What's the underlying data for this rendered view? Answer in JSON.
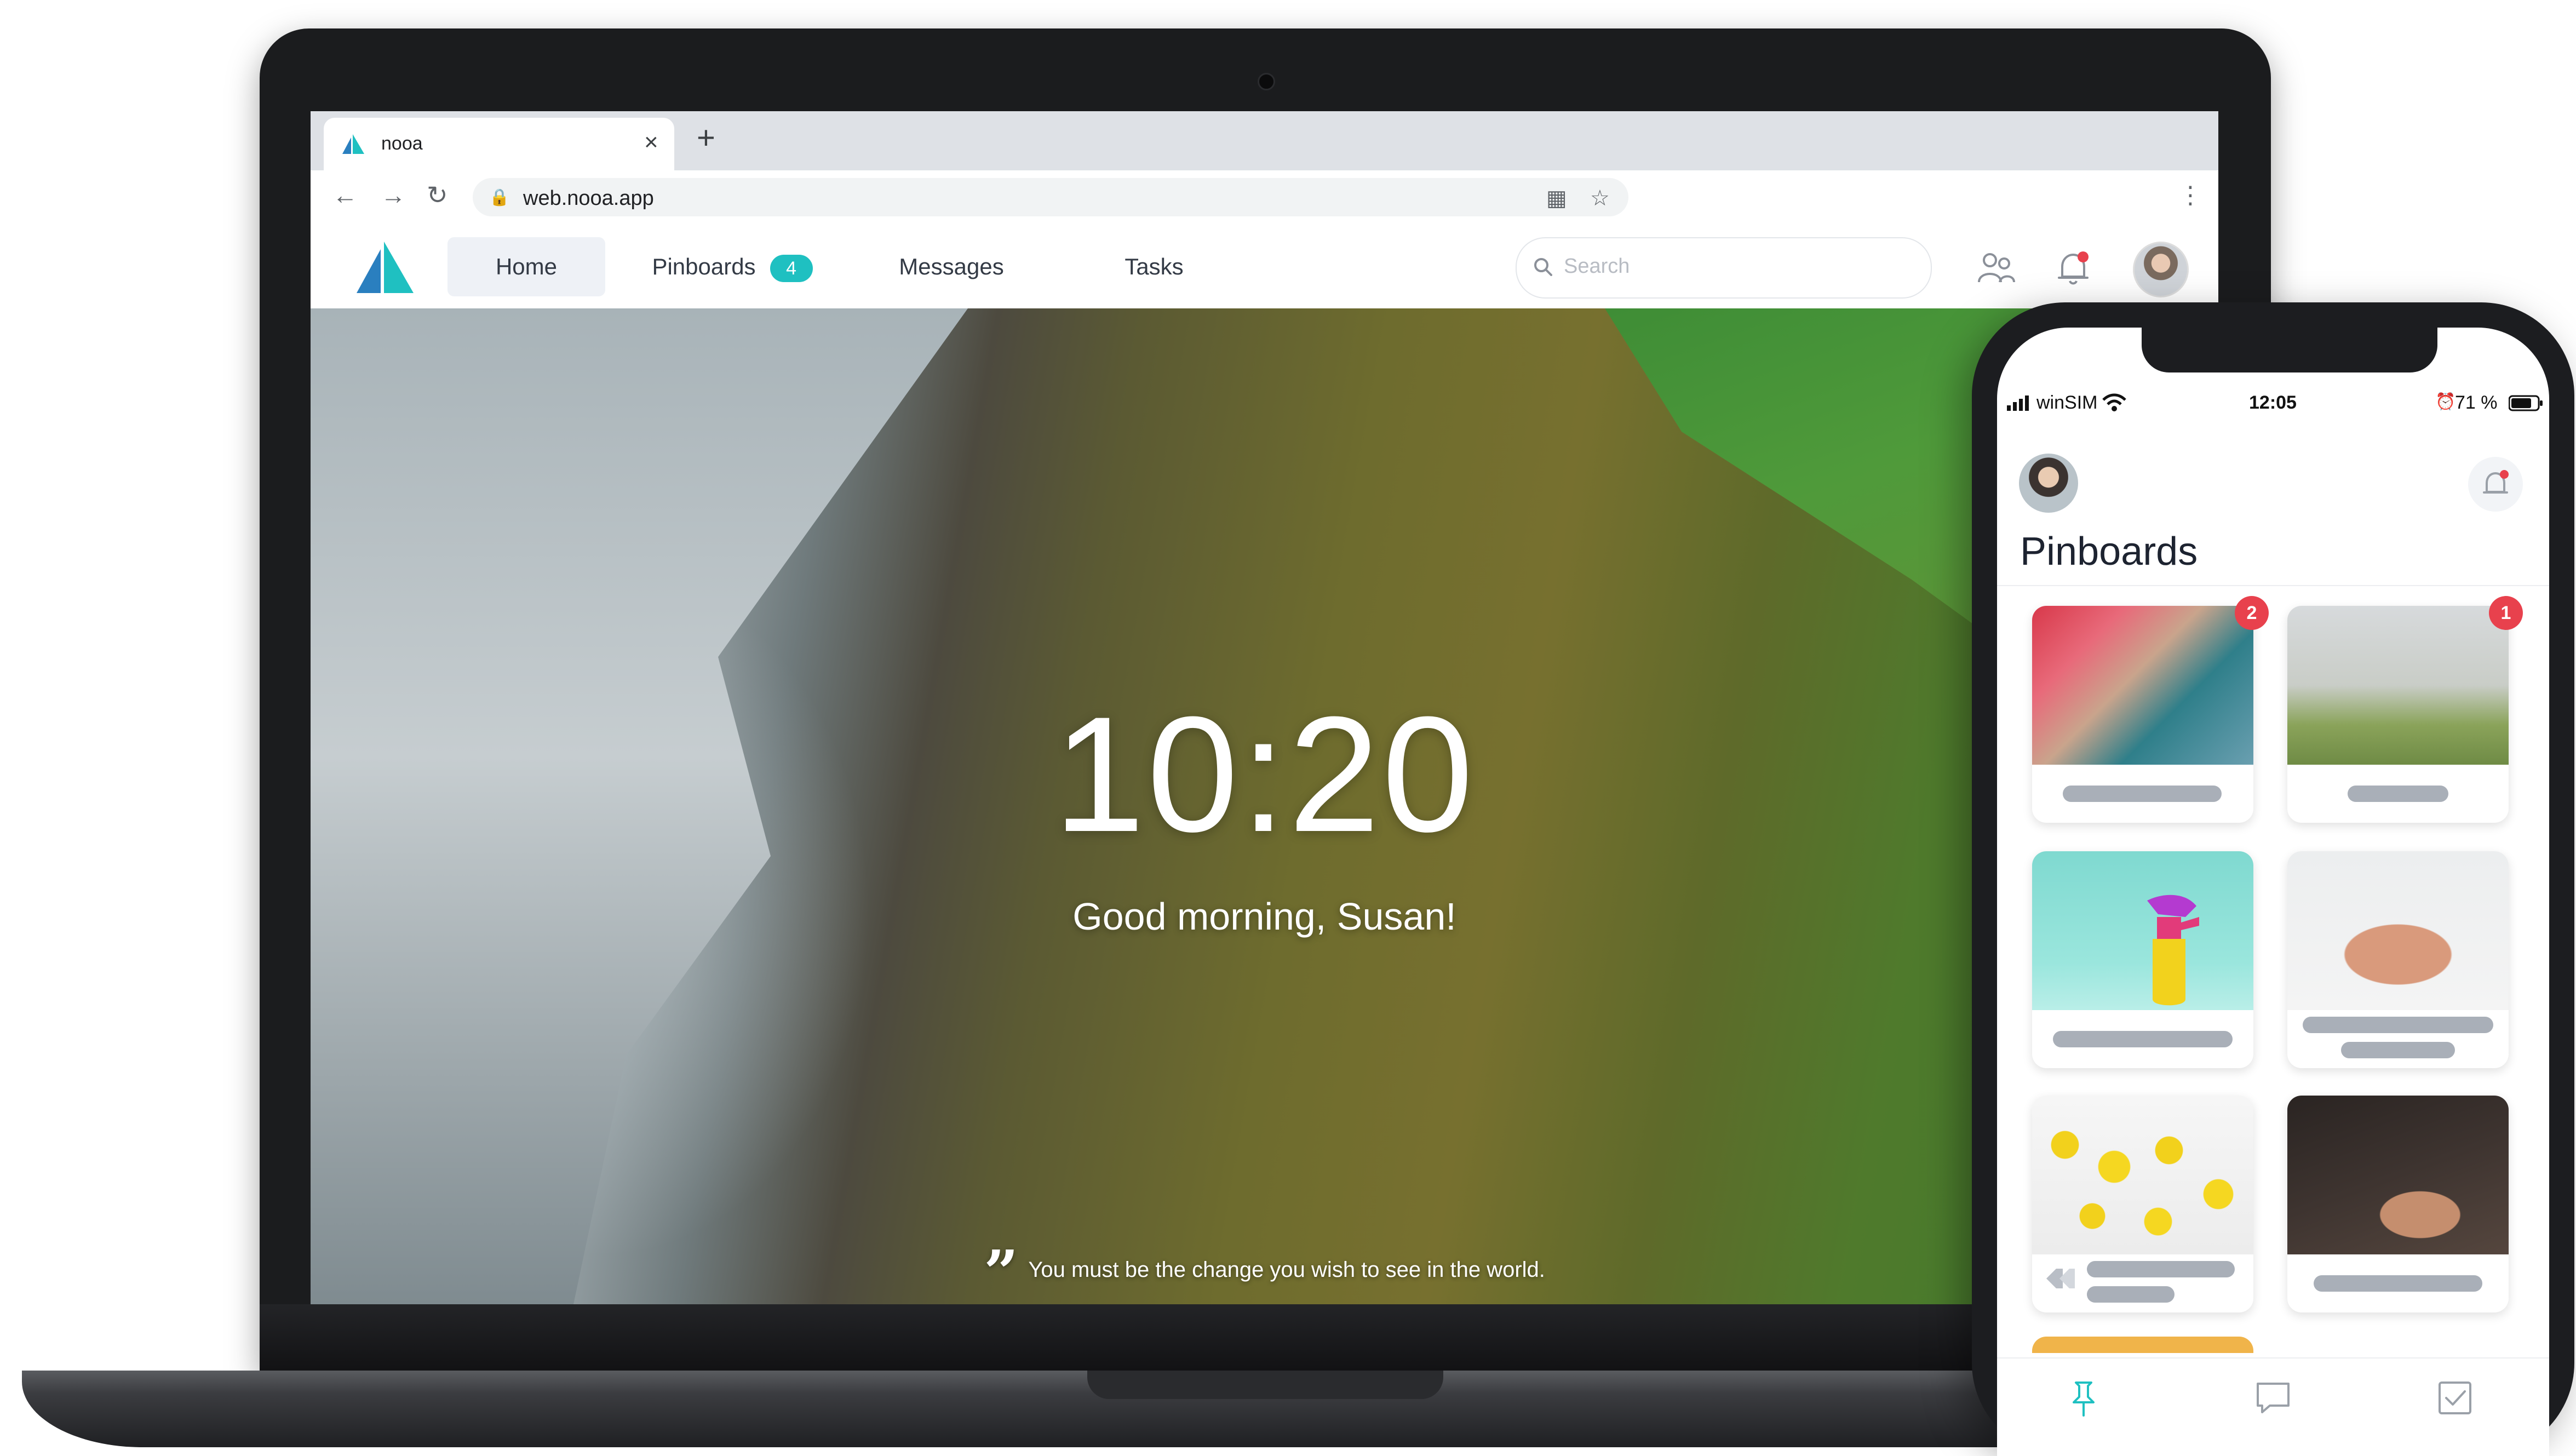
{
  "browser": {
    "tab_title": "nooa",
    "tab_close": "×",
    "new_tab": "+",
    "url": "web.nooa.app",
    "back": "←",
    "forward": "→",
    "reload": "↻",
    "lock": "🔒",
    "qr": "▦",
    "star": "☆",
    "menu": "⋮"
  },
  "app": {
    "nav": {
      "home": "Home",
      "pinboards": "Pinboards",
      "pinboards_badge": "4",
      "messages": "Messages",
      "tasks": "Tasks"
    },
    "search_placeholder": "Search",
    "icons": [
      "nooa-logo-icon",
      "people-icon",
      "bell-icon",
      "avatar"
    ],
    "accent": "#1fc0c1"
  },
  "hero": {
    "time": "10:20",
    "greeting": "Good morning, Susan!",
    "quote_mark": "”",
    "quote": "You must be the change you wish to see in the world."
  },
  "phone": {
    "carrier": "winSIM",
    "time": "12:05",
    "battery": "71 %",
    "title": "Pinboards",
    "cards": [
      {
        "badge": "2"
      },
      {
        "badge": "1"
      },
      {
        "badge": ""
      },
      {
        "badge": ""
      },
      {
        "badge": ""
      },
      {
        "badge": ""
      }
    ],
    "badge_color": "#e8414d",
    "tab_icons": [
      "pin-icon",
      "chat-icon",
      "checkbox-icon"
    ]
  }
}
